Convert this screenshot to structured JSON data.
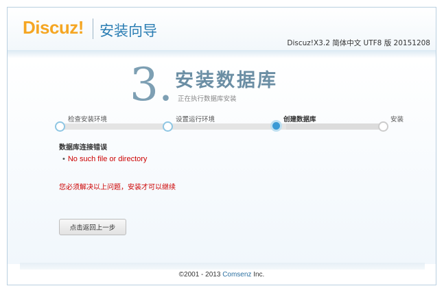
{
  "header": {
    "logo": "Discuz!",
    "title": "安装向导",
    "version": "Discuz!X3.2 简体中文 UTF8 版 20151208"
  },
  "step": {
    "number": "3.",
    "title": "安装数据库",
    "subtitle": "正在执行数据库安装"
  },
  "steps": [
    {
      "label": "检查安装环境",
      "state": "done"
    },
    {
      "label": "设置运行环境",
      "state": "done"
    },
    {
      "label": "创建数据库",
      "state": "current"
    },
    {
      "label": "安装",
      "state": "future"
    }
  ],
  "error": {
    "title": "数据库连接错误",
    "items": [
      "No such file or directory"
    ],
    "must_fix": "您必须解决以上问题，安装才可以继续"
  },
  "back_button": "点击返回上一步",
  "footer": {
    "copyright": "©2001 - 2013 ",
    "brand": "Comsenz",
    "suffix": " Inc."
  },
  "colors": {
    "accent": "#2a7db3",
    "logo": "#f5a623",
    "error": "#cc0000"
  }
}
